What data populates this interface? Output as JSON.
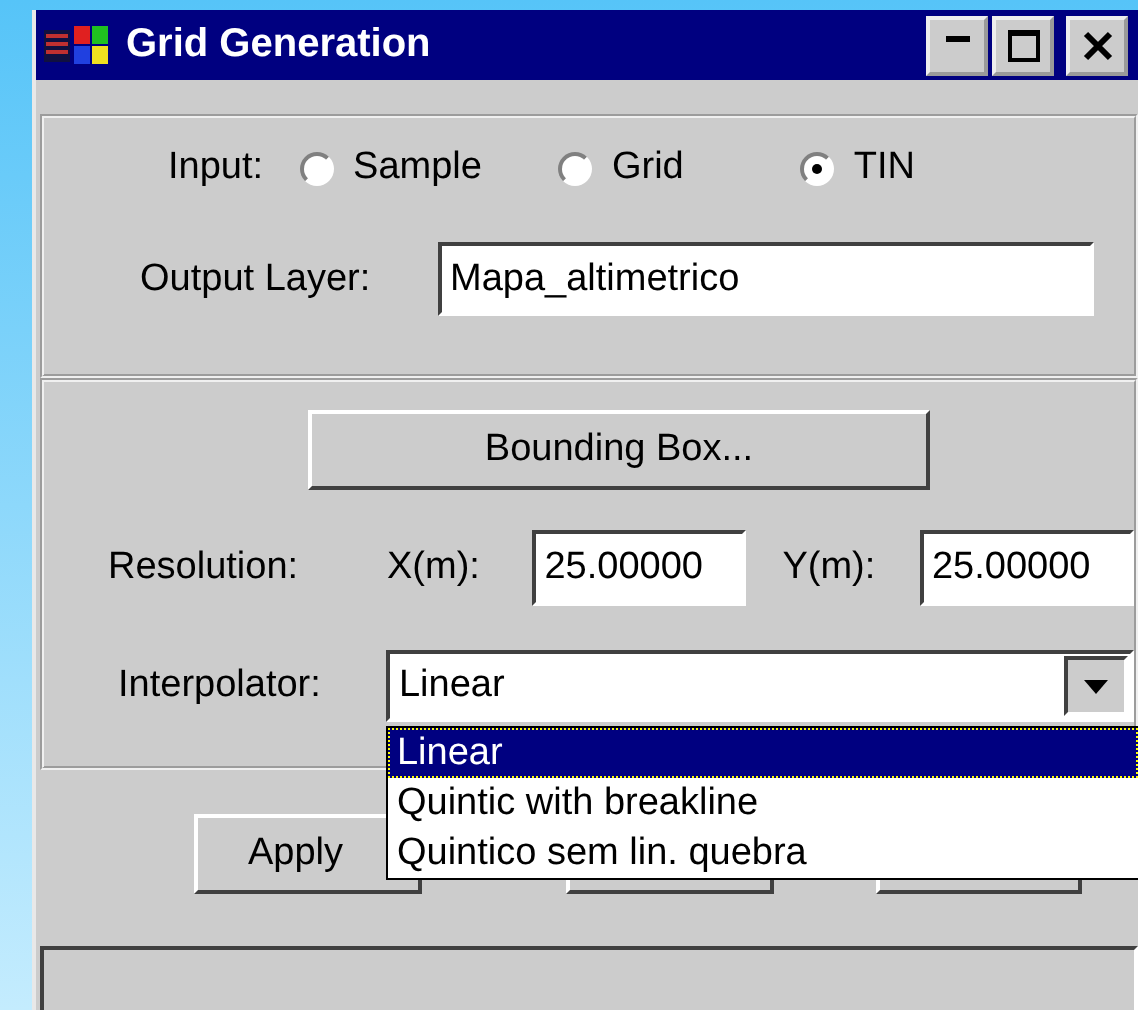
{
  "window": {
    "title": "Grid Generation"
  },
  "input": {
    "label": "Input:",
    "options": [
      {
        "label": "Sample",
        "selected": false
      },
      {
        "label": "Grid",
        "selected": false
      },
      {
        "label": "TIN",
        "selected": true
      }
    ]
  },
  "output_layer": {
    "label": "Output Layer:",
    "value": "Mapa_altimetrico"
  },
  "bounding_box_button": "Bounding Box...",
  "resolution": {
    "label": "Resolution:",
    "x_label": "X(m):",
    "x_value": "25.00000",
    "y_label": "Y(m):",
    "y_value": "25.00000"
  },
  "interpolator": {
    "label": "Interpolator:",
    "value": "Linear",
    "expanded": true,
    "options": [
      {
        "label": "Linear",
        "selected": true
      },
      {
        "label": "Quintic with breakline",
        "selected": false
      },
      {
        "label": "Quintico sem lin. quebra",
        "selected": false
      }
    ]
  },
  "buttons": [
    {
      "kind": "labeled",
      "label": "Apply"
    },
    {
      "kind": "covered"
    },
    {
      "kind": "covered"
    }
  ]
}
